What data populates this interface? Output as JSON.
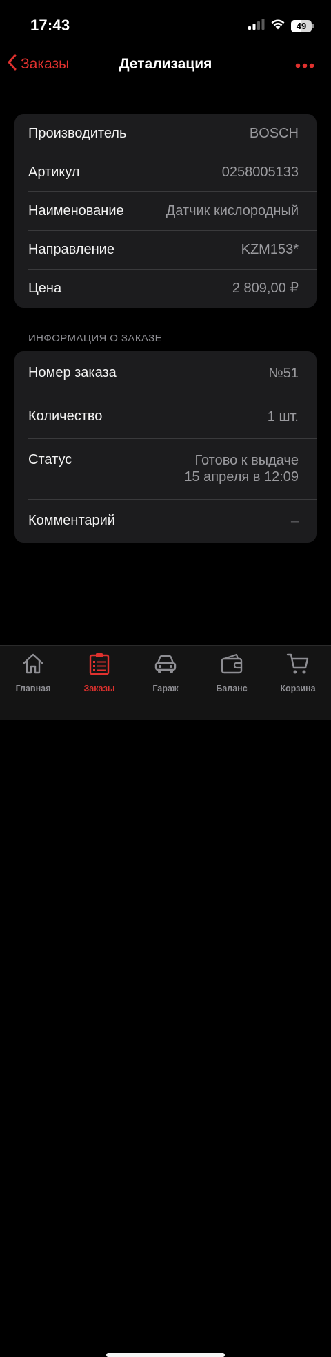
{
  "status_bar": {
    "time": "17:43",
    "battery": "49",
    "battery_level": 0.49
  },
  "nav": {
    "back_label": "Заказы",
    "title": "Детализация"
  },
  "details": [
    {
      "label": "Производитель",
      "value": "BOSCH"
    },
    {
      "label": "Артикул",
      "value": "0258005133"
    },
    {
      "label": "Наименование",
      "value": "Датчик кислородный"
    },
    {
      "label": "Направление",
      "value": "KZM153*"
    },
    {
      "label": "Цена",
      "value": "2 809,00 ₽"
    }
  ],
  "order_section": {
    "header": "ИНФОРМАЦИЯ О ЗАКАЗЕ",
    "rows": [
      {
        "label": "Номер заказа",
        "value": "№51"
      },
      {
        "label": "Количество",
        "value": "1 шт."
      },
      {
        "label": "Статус",
        "value_line1": "Готово к выдаче",
        "value_line2": "15 апреля в 12:09"
      },
      {
        "label": "Комментарий",
        "value": "–"
      }
    ]
  },
  "tabs": [
    {
      "label": "Главная",
      "icon": "home-icon",
      "active": false
    },
    {
      "label": "Заказы",
      "icon": "orders-icon",
      "active": true
    },
    {
      "label": "Гараж",
      "icon": "car-icon",
      "active": false
    },
    {
      "label": "Баланс",
      "icon": "wallet-icon",
      "active": false
    },
    {
      "label": "Корзина",
      "icon": "cart-icon",
      "active": false
    }
  ],
  "colors": {
    "accent": "#e0312e",
    "background": "#000000",
    "card": "#1c1c1e",
    "secondary_text": "#9a9a9e"
  }
}
